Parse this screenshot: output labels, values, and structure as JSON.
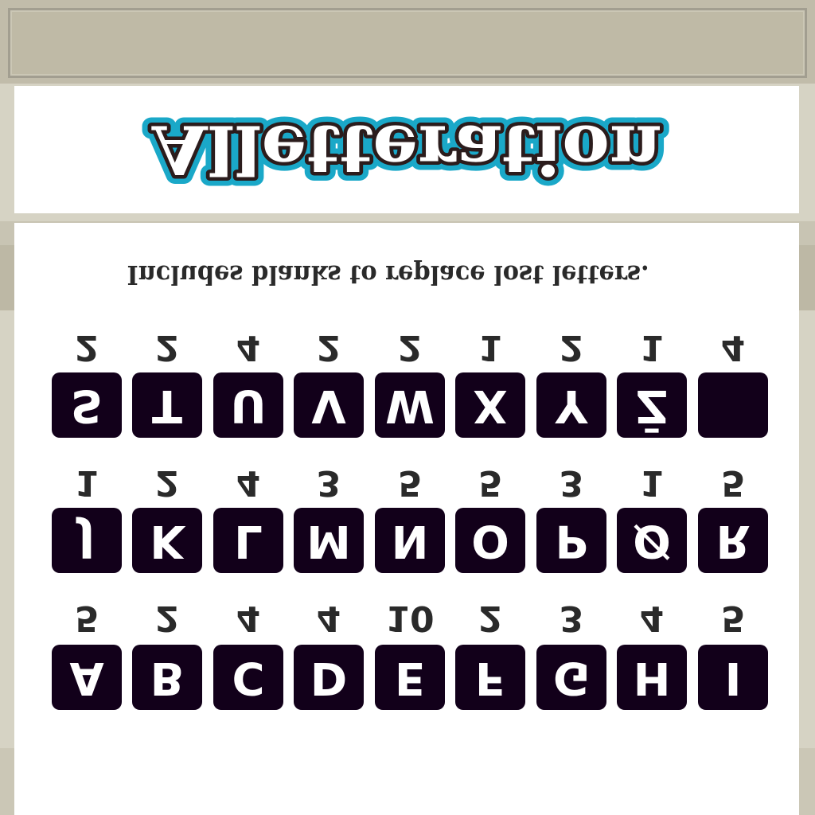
{
  "title": "Alletteration",
  "subtitle": "Includes blanks to replace lost letters.",
  "colors": {
    "tile_bg": "#12001a",
    "title_outline": "#1aa8c8",
    "title_inner": "#2b1c1c"
  },
  "rows": [
    {
      "tiles": [
        {
          "letter": "S",
          "count": "2"
        },
        {
          "letter": "T",
          "count": "2"
        },
        {
          "letter": "U",
          "count": "4"
        },
        {
          "letter": "V",
          "count": "2"
        },
        {
          "letter": "W",
          "count": "2"
        },
        {
          "letter": "X",
          "count": "1"
        },
        {
          "letter": "Y",
          "count": "2"
        },
        {
          "letter": "Z̄",
          "count": "1"
        },
        {
          "letter": "",
          "count": "4"
        }
      ]
    },
    {
      "tiles": [
        {
          "letter": "J",
          "count": "1"
        },
        {
          "letter": "K",
          "count": "2"
        },
        {
          "letter": "L",
          "count": "4"
        },
        {
          "letter": "M",
          "count": "3"
        },
        {
          "letter": "N",
          "count": "5"
        },
        {
          "letter": "O",
          "count": "5"
        },
        {
          "letter": "P",
          "count": "3"
        },
        {
          "letter": "Ø",
          "count": "1"
        },
        {
          "letter": "R",
          "count": "5"
        }
      ]
    },
    {
      "tiles": [
        {
          "letter": "A",
          "count": "5"
        },
        {
          "letter": "B",
          "count": "2"
        },
        {
          "letter": "C",
          "count": "4"
        },
        {
          "letter": "D",
          "count": "4"
        },
        {
          "letter": "E",
          "count": "10"
        },
        {
          "letter": "F",
          "count": "2"
        },
        {
          "letter": "G",
          "count": "3"
        },
        {
          "letter": "H",
          "count": "4"
        },
        {
          "letter": "I",
          "count": "5"
        }
      ]
    }
  ]
}
